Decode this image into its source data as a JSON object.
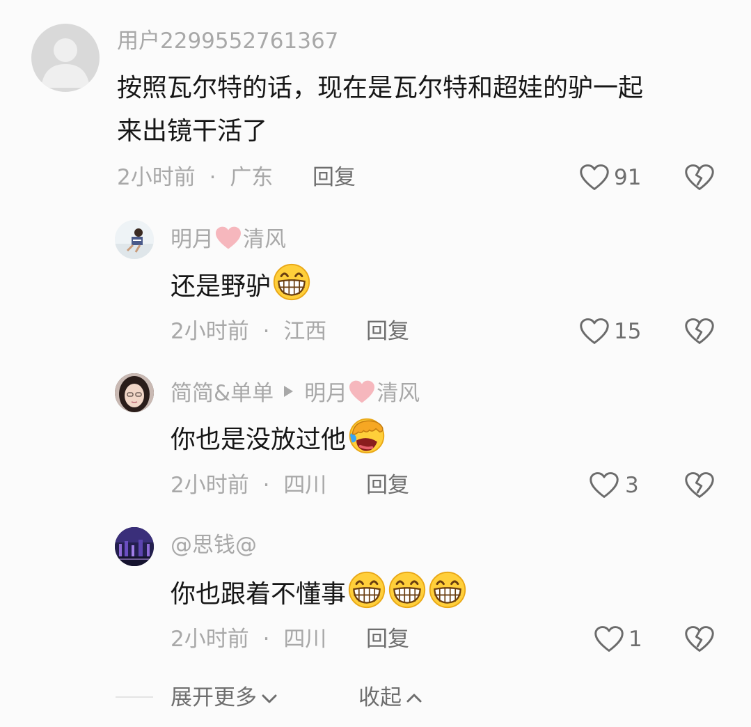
{
  "comments": [
    {
      "username": "用户2299552761367",
      "text": "按照瓦尔特的话，现在是瓦尔特和超娃的驴一起",
      "text_line2": "来出镜干活了",
      "time": "2小时前",
      "location": "广东",
      "reply_label": "回复",
      "likes": "91"
    }
  ],
  "replies": [
    {
      "username_part1": "明月",
      "username_part2": "清风",
      "text": "还是野驴",
      "time": "2小时前",
      "location": "江西",
      "reply_label": "回复",
      "likes": "15"
    },
    {
      "username": "简简&单单",
      "reply_to_part1": "明月",
      "reply_to_part2": "清风",
      "text": "你也是没放过他",
      "time": "2小时前",
      "location": "四川",
      "reply_label": "回复",
      "likes": "3"
    },
    {
      "username": "@思钱@",
      "text": "你也跟着不懂事",
      "time": "2小时前",
      "location": "四川",
      "reply_label": "回复",
      "likes": "1"
    }
  ],
  "footer": {
    "expand_label": "展开更多",
    "collapse_label": "收起"
  },
  "separator": "·",
  "icons": {
    "like": "heart-outline-icon",
    "dislike": "broken-heart-icon",
    "emoji_grin": "grinning-emoji-icon",
    "emoji_facepalm": "facepalm-laugh-emoji-icon"
  },
  "colors": {
    "background": "#fbfbfb",
    "text_primary": "#161616",
    "text_secondary": "#a8a8a8",
    "icon": "#6e6e6e",
    "heart_pink": "#f5b8bd"
  }
}
